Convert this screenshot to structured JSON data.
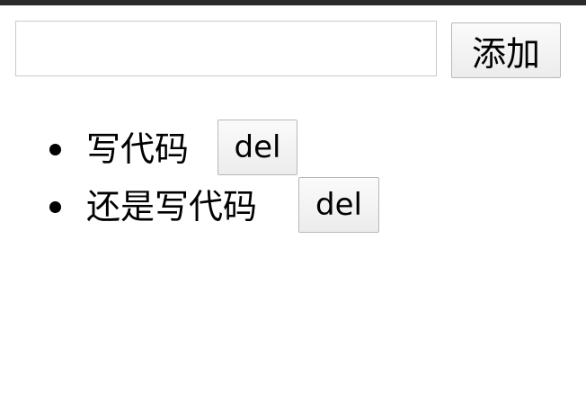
{
  "add_form": {
    "input_value": "",
    "input_placeholder": "",
    "add_button_label": "添加"
  },
  "todos": [
    {
      "text": "写代码",
      "delete_label": "del"
    },
    {
      "text": "还是写代码",
      "delete_label": "del"
    }
  ]
}
